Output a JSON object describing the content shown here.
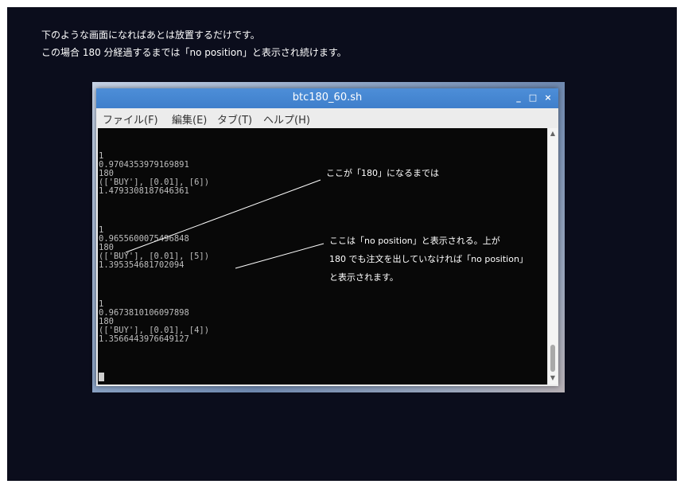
{
  "caption": {
    "line1": "下のような画面になればあとは放置するだけです。",
    "line2": "この場合 180 分経過するまでは「no position」と表示され続けます。"
  },
  "window": {
    "title": "btc180_60.sh",
    "controls": {
      "minimize": "_",
      "maximize": "□",
      "close": "×"
    }
  },
  "menu": [
    {
      "label": "ファイル(F)"
    },
    {
      "label": "編集(E)"
    },
    {
      "label": "タブ(T)"
    },
    {
      "label": "ヘルプ(H)"
    }
  ],
  "terminal": {
    "lines": [
      "1",
      "0.9704353979169891",
      "180",
      "(['BUY'], [0.01], [6])",
      "1.4793308187646361",
      "",
      "",
      "1",
      "0.9655600075496848",
      "180",
      "(['BUY'], [0.01], [5])",
      "1.395354681702094",
      "",
      "",
      "1",
      "0.9673810106097898",
      "180",
      "(['BUY'], [0.01], [4])",
      "1.3566443976649127"
    ]
  },
  "scrollbar": {
    "up_arrow": "▲",
    "down_arrow": "▼"
  },
  "annotations": {
    "note1": "ここが「180」になるまでは",
    "note2_line1": "ここは「no position」と表示される。上が",
    "note2_line2": "180 でも注文を出していなければ「no position」",
    "note2_line3": "と表示されます。"
  }
}
